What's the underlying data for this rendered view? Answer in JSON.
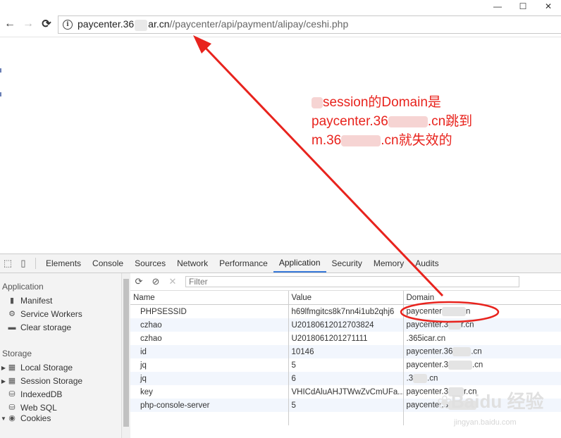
{
  "window": {
    "minimize": "—",
    "maximize": "☐",
    "close": "✕"
  },
  "toolbar": {
    "back": "←",
    "forward": "→",
    "reload": "⟳",
    "url_host_start": "paycenter.36",
    "url_host_end": "ar.cn",
    "url_path": "//paycenter/api/payment/alipay/ceshi.php"
  },
  "annotation": {
    "line1": "session的Domain是",
    "line2_a": "paycenter.36",
    "line2_b": ".cn跳到",
    "line3_a": "m.36",
    "line3_b": ".cn就失效的",
    "color": "#e8231d"
  },
  "devtools": {
    "tabs": [
      "Elements",
      "Console",
      "Sources",
      "Network",
      "Performance",
      "Application",
      "Security",
      "Memory",
      "Audits"
    ],
    "active_tab": "Application",
    "sidebar": {
      "application_title": "Application",
      "application_items": [
        "Manifest",
        "Service Workers",
        "Clear storage"
      ],
      "storage_title": "Storage",
      "storage_items": [
        "Local Storage",
        "Session Storage",
        "IndexedDB",
        "Web SQL",
        "Cookies"
      ]
    },
    "filter_placeholder": "Filter",
    "columns": [
      "Name",
      "Value",
      "Domain"
    ],
    "rows": [
      {
        "name": "PHPSESSID",
        "value": "h69lfmgitcs8k7nn4i1ub2qhj6",
        "domain_a": "paycenter",
        "domain_b": "n"
      },
      {
        "name": "czhao",
        "value": "U2018061201270382​4",
        "domain_a": "paycenter.3",
        "domain_b": "r.cn"
      },
      {
        "name": "czhao",
        "value": "U2018061201271111",
        "domain_a": ".365icar.cn",
        "domain_b": ""
      },
      {
        "name": "id",
        "value": "10146",
        "domain_a": "paycenter.36",
        "domain_b": ".cn"
      },
      {
        "name": "jq",
        "value": "5",
        "domain_a": "paycenter.3",
        "domain_b": ".cn"
      },
      {
        "name": "jq",
        "value": "6",
        "domain_a": ".3",
        "domain_b": ".cn"
      },
      {
        "name": "key",
        "value": "VHICdAluAHJTWwZvCmUFa...",
        "domain_a": "paycenter.3",
        "domain_b": "r.cn"
      },
      {
        "name": "php-console-server",
        "value": "5",
        "domain_a": "paycenter.3",
        "domain_b": ""
      }
    ]
  },
  "watermark": {
    "brand": "Baidu 经验",
    "sub": "jingyan.baidu.com"
  }
}
